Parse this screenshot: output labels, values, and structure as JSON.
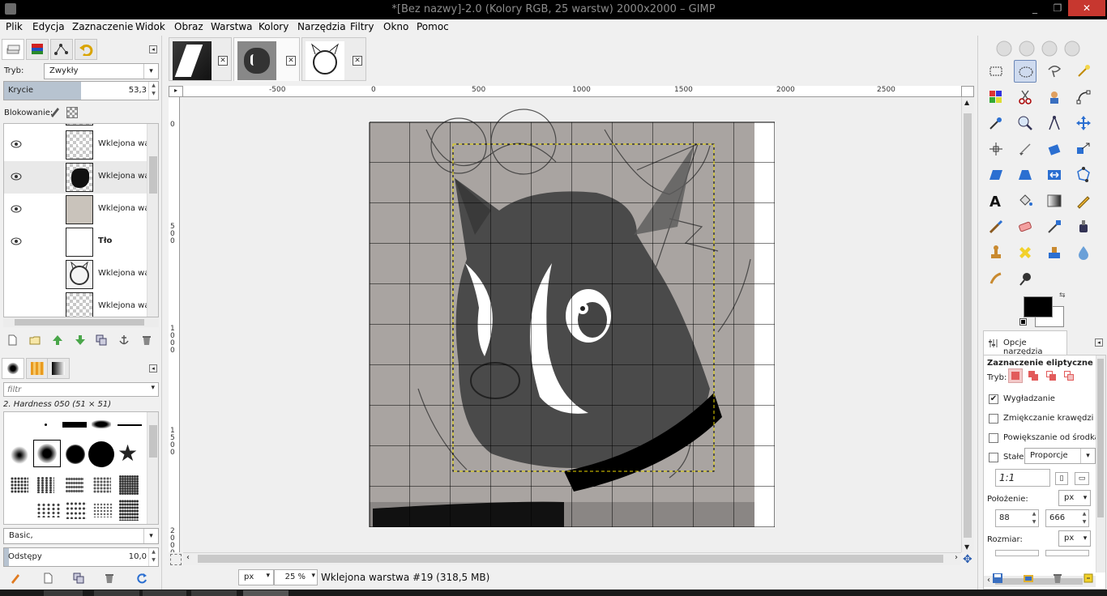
{
  "window": {
    "title": "*[Bez nazwy]-2.0 (Kolory RGB, 25 warstw) 2000x2000 – GIMP",
    "minimize": "_",
    "maximize": "❐",
    "close": "✕"
  },
  "menu": [
    "Plik",
    "Edycja",
    "Zaznaczenie",
    "Widok",
    "Obraz",
    "Warstwa",
    "Kolory",
    "Narzędzia",
    "Filtry",
    "Okno",
    "Pomoc"
  ],
  "layers_panel": {
    "mode_label": "Tryb:",
    "mode_value": "Zwykły",
    "opacity_label": "Krycie",
    "opacity_value": "53,3",
    "opacity_fraction": 0.533,
    "lock_label": "Blokowanie:",
    "layers": [
      {
        "name": "Wklejona warstwa",
        "visible": true,
        "bold": false
      },
      {
        "name": "Wklejona warstwa",
        "visible": true,
        "bold": false
      },
      {
        "name": "Wklejona warstwa",
        "visible": true,
        "bold": false
      },
      {
        "name": "Tło",
        "visible": true,
        "bold": true
      },
      {
        "name": "Wklejona warstwa",
        "visible": false,
        "bold": false
      },
      {
        "name": "Wklejona warstwa",
        "visible": false,
        "bold": false
      }
    ]
  },
  "brushes_panel": {
    "filter_placeholder": "filtr",
    "brush_name": "2. Hardness 050 (51 × 51)",
    "preset": "Basic,",
    "spacing_label": "Odstępy",
    "spacing_value": "10,0"
  },
  "canvas": {
    "ruler_h_labels": [
      "-500",
      "0",
      "500",
      "1000",
      "1500",
      "2000",
      "2500"
    ],
    "ruler_v_labels": [
      "0",
      "500",
      "1000",
      "1500",
      "2000"
    ],
    "grid_color": "#000000",
    "selection_color": "#e8d600"
  },
  "status": {
    "unit": "px",
    "zoom": "25 %",
    "text": "Wklejona warstwa #19 (318,5 MB)"
  },
  "tool_options": {
    "tab_label": "Opcje narzędzia",
    "title": "Zaznaczenie eliptyczne",
    "mode_label": "Tryb:",
    "antialias_label": "Wygładzanie",
    "antialias_checked": true,
    "feather_label": "Zmiękczanie krawędzi",
    "feather_checked": false,
    "expand_label": "Powiększanie od środka",
    "expand_checked": false,
    "fixed_label": "Stałe:",
    "fixed_checked": false,
    "fixed_value": "Proporcje",
    "ratio_value": "1:1",
    "position_label": "Położenie:",
    "position_unit": "px",
    "pos_x": "88",
    "pos_y": "666",
    "size_label": "Rozmiar:",
    "size_unit": "px"
  },
  "colors": {
    "foreground": "#000000",
    "background": "#ffffff"
  }
}
